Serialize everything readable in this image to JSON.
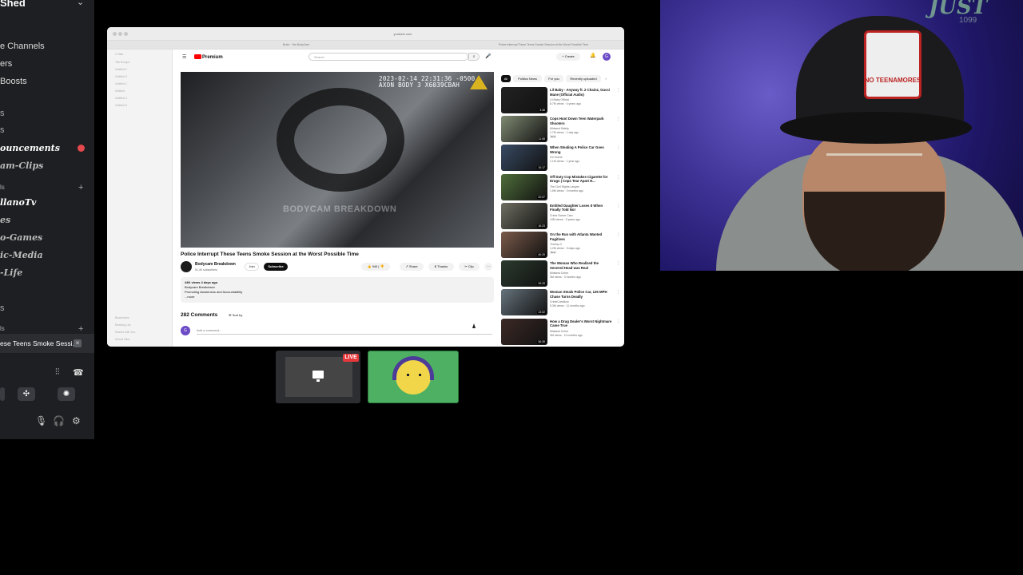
{
  "discord": {
    "server_name": "Shed",
    "items": [
      {
        "label": "e Channels",
        "style": "normal"
      },
      {
        "label": "ers",
        "style": "normal"
      },
      {
        "label": "Boosts",
        "style": "normal"
      },
      {
        "label": "s",
        "style": "muted"
      },
      {
        "label": "s",
        "style": "muted"
      },
      {
        "label": "ouncements",
        "style": "fancy"
      },
      {
        "label": "am-Clips",
        "style": "fancy"
      },
      {
        "label": "ls",
        "style": "muted"
      },
      {
        "label": "llanoTv",
        "style": "fancy"
      },
      {
        "label": "es",
        "style": "fancy"
      },
      {
        "label": "o-Games",
        "style": "fancy"
      },
      {
        "label": "ic-Media",
        "style": "fancy"
      },
      {
        "label": "-Life",
        "style": "fancy"
      },
      {
        "label": "s",
        "style": "muted"
      },
      {
        "label": "ls",
        "style": "muted"
      }
    ],
    "voice_activity": "ese Teens Smoke Sessi...",
    "voice_close": "×",
    "controls": [
      "waveform-icon",
      "hangup-icon",
      "activities-icon",
      "soundboard-icon"
    ],
    "bottom_icons": [
      "microphone-icon",
      "headphones-icon",
      "settings-icon"
    ]
  },
  "browser": {
    "url": "youtube.com",
    "tabs": [
      "Brain · Yes BodyCam",
      "Police Interrupt These Teens Smoke Session at the Worst Possible Time"
    ],
    "sidebar_rows": [
      "2 Tabs",
      "Tab Groups",
      "Untitled 2",
      "Untitled 3",
      "Untitled 1",
      "Untitled",
      "Untitled 4",
      "Untitled 5",
      "Bookmarks",
      "Reading List",
      "Shared with You",
      "iCloud Tabs"
    ]
  },
  "youtube": {
    "logo": "Premium",
    "search_placeholder": "Search",
    "create_label": "+ Create",
    "avatar_letter": "G",
    "video": {
      "timestamp": "2023-02-14 22:31:36 -0500",
      "device": "AXON BODY 3 X6039CBAH",
      "watermark": "BODYCAM BREAKDOWN",
      "title": "Police Interrupt These Teens Smoke Session at the Worst Possible Time"
    },
    "channel": {
      "name": "Bodycam Breakdown",
      "subscribers": "51.4K subscribers",
      "join": "Join",
      "subscribe": "Subscribe"
    },
    "actions": {
      "likes": "940",
      "share": "Share",
      "thanks": "Thanks",
      "clip": "Clip"
    },
    "description": {
      "stats": "44K views  4 days ago",
      "line1": "Bodycam Breakdown",
      "line2": "Promoting Awareness and Accountability",
      "more": "...more"
    },
    "comments": {
      "count": "282 Comments",
      "sort": "Sort by",
      "placeholder": "Add a comment..."
    },
    "chips": [
      "All",
      "Politics News",
      "For you",
      "Recently uploaded"
    ],
    "recommendations": [
      {
        "title": "Lil Baby - Anyway ft. 2 Chainz, Gucci Mane (Official Audio)",
        "channel": "Lil Baby Official",
        "meta": "8.7M views · 4 years ago",
        "duration": "3:48",
        "new": "",
        "color": "#222222"
      },
      {
        "title": "Cops Hunt Down Teen Waterpark Shooters",
        "channel": "Midwest Safety",
        "meta": "1.7M views · 1 day ago",
        "duration": "11:08",
        "new": "New",
        "color": "#7f8a72"
      },
      {
        "title": "When Stealing A Police Car Goes Wrong",
        "channel": "On Scene",
        "meta": "1.1M views · 1 year ago",
        "duration": "10:17",
        "new": "",
        "color": "#384a63"
      },
      {
        "title": "Off Duty Cop Mistakes Cigarette for Drugs | Cops Tear Apart H...",
        "channel": "The Civil Rights Lawyer",
        "meta": "1.6M views · 3 months ago",
        "duration": "20:07",
        "new": "",
        "color": "#4f6d3a"
      },
      {
        "title": "Entitled Daughter Loses It When Finally Told No!",
        "channel": "Crime Scene Cam",
        "meta": "10M views · 2 years ago",
        "duration": "16:23",
        "new": "",
        "color": "#6e6e62"
      },
      {
        "title": "On the Run with Atlanta Wanted Fugitives",
        "channel": "Tommy G",
        "meta": "1.2M views · 3 days ago",
        "duration": "40:29",
        "new": "New",
        "color": "#7a5a4a"
      },
      {
        "title": "The Woman Who Realized the Severed Head was Real",
        "channel": "Midwest Crime",
        "meta": "3M views · 3 months ago",
        "duration": "39:33",
        "new": "",
        "color": "#2b3a2e"
      },
      {
        "title": "Woman Steals Police Car, 125 MPH Chase Turns Deadly",
        "channel": "CrimeCamNow",
        "meta": "5.3M views · 11 months ago",
        "duration": "13:02",
        "new": "",
        "color": "#66737c"
      },
      {
        "title": "How a Drug Dealer's Worst Nightmare Came True",
        "channel": "Midwest Crime",
        "meta": "3M views · 10 months ago",
        "duration": "36:39",
        "new": "",
        "color": "#3c2a26"
      }
    ]
  },
  "stream": {
    "live_label": "LIVE"
  },
  "webcam": {
    "cap_patch": "NO TEENAMORES",
    "sign": "JUST",
    "sign_sub": "1099"
  }
}
